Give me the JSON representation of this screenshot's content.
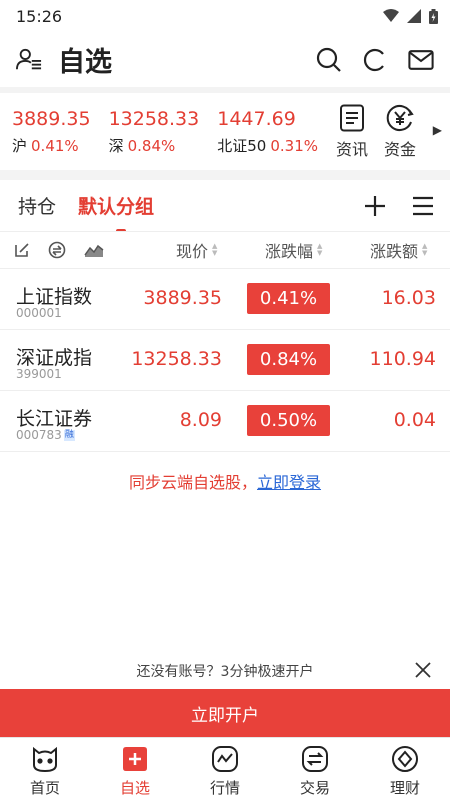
{
  "status_bar": {
    "time": "15:26"
  },
  "header": {
    "title": "自选"
  },
  "indices": [
    {
      "value": "3889.35",
      "name": "沪",
      "pct": "0.41%"
    },
    {
      "value": "13258.33",
      "name": "深",
      "pct": "0.84%"
    },
    {
      "value": "1447.69",
      "name": "北证50",
      "pct": "0.31%"
    }
  ],
  "quick_links": {
    "news": "资讯",
    "funds": "资金"
  },
  "groups": {
    "holdings": "持仓",
    "default_group": "默认分组"
  },
  "columns": {
    "price": "现价",
    "change_pct": "涨跌幅",
    "change_amt": "涨跌额"
  },
  "stocks": [
    {
      "name": "上证指数",
      "code": "000001",
      "price": "3889.35",
      "pct": "0.41%",
      "chg": "16.03"
    },
    {
      "name": "深证成指",
      "code": "399001",
      "price": "13258.33",
      "pct": "0.84%",
      "chg": "110.94"
    },
    {
      "name": "长江证券",
      "code": "000783",
      "tag": "融",
      "price": "8.09",
      "pct": "0.50%",
      "chg": "0.04"
    }
  ],
  "sync": {
    "text": "同步云端自选股，",
    "link": "立即登录"
  },
  "promo": {
    "text": "还没有账号？3分钟极速开户",
    "button": "立即开户"
  },
  "tabbar": [
    {
      "label": "首页",
      "icon": "home-icon"
    },
    {
      "label": "自选",
      "icon": "watchlist-icon"
    },
    {
      "label": "行情",
      "icon": "market-icon"
    },
    {
      "label": "交易",
      "icon": "trade-icon"
    },
    {
      "label": "理财",
      "icon": "finance-icon"
    }
  ],
  "colors": {
    "accent": "#e8413a",
    "rise": "#e33e33",
    "link": "#2a67d6"
  }
}
